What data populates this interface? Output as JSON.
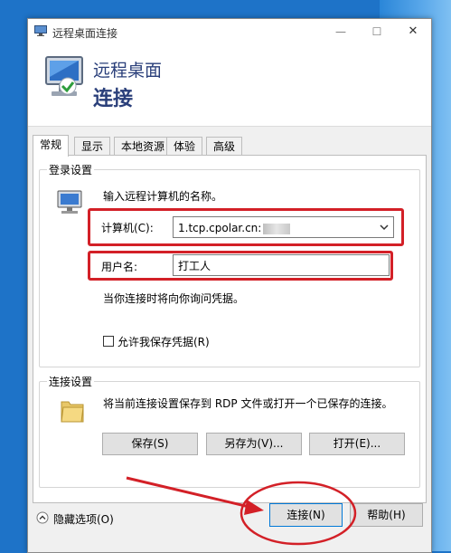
{
  "window": {
    "title": "远程桌面连接",
    "minimize_glyph": "—",
    "maximize_glyph": "☐",
    "close_glyph": "✕"
  },
  "banner": {
    "line1": "远程桌面",
    "line2": "连接"
  },
  "tabs": [
    {
      "label": "常规",
      "active": true
    },
    {
      "label": "显示",
      "active": false
    },
    {
      "label": "本地资源",
      "active": false
    },
    {
      "label": "体验",
      "active": false
    },
    {
      "label": "高级",
      "active": false
    }
  ],
  "login": {
    "group_label": "登录设置",
    "instruction": "输入远程计算机的名称。",
    "computer_label": "计算机(C):",
    "computer_value": "1.tcp.cpolar.cn:",
    "username_label": "用户名:",
    "username_value": "打工人",
    "credentials_note": "当你连接时将向你询问凭据。",
    "save_credentials_label": "允许我保存凭据(R)",
    "save_credentials_checked": false
  },
  "connection": {
    "group_label": "连接设置",
    "description": "将当前连接设置保存到 RDP 文件或打开一个已保存的连接。",
    "save_label": "保存(S)",
    "save_as_label": "另存为(V)...",
    "open_label": "打开(E)..."
  },
  "footer": {
    "hide_options_label": "隐藏选项(O)",
    "connect_label": "连接(N)",
    "help_label": "帮助(H)"
  },
  "colors": {
    "highlight": "#d32027",
    "banner_text": "#2a3f7a",
    "desktop": "#1e73c8"
  }
}
